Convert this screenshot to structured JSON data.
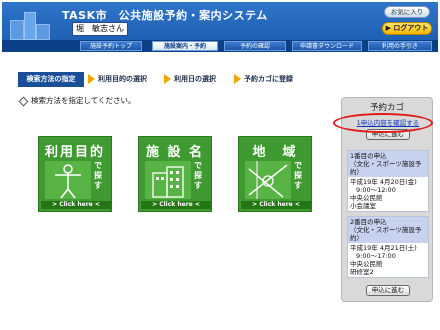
{
  "header": {
    "title": "TASK市　公共施設予約・案内システム",
    "user": "堀　敏志さん",
    "favorites": "お気に入り",
    "logout": "▶ ログアウト"
  },
  "nav": {
    "items": [
      "施設予約トップ",
      "施設案内・予約",
      "予約の確認",
      "申請書ダウンロード",
      "利用の手引き"
    ],
    "active_index": 1
  },
  "steps": {
    "current": "検索方法の指定",
    "next": [
      "利用目的の選択",
      "利用日の選択",
      "予約カゴに登録"
    ]
  },
  "instruction": "検索方法を指定してください。",
  "tiles": [
    {
      "title": "利用目的",
      "vertical": "で探す",
      "click": "> Click here <",
      "icon": "person-icon"
    },
    {
      "title": "施 設 名",
      "vertical": "で探す",
      "click": "> Click here <",
      "icon": "building-icon"
    },
    {
      "title": "地　域",
      "vertical": "で探す",
      "click": "> Click here <",
      "icon": "map-icon"
    }
  ],
  "cart": {
    "title": "予約カゴ",
    "confirm_link": "1申込内容を確認する",
    "apply_button": "申込に進む",
    "entries": [
      {
        "head1": "1番目の申込",
        "head2": "（文化・スポーツ施設予約）",
        "date": "平成19年 4月20日(金)",
        "time": "9:00～12:00",
        "place": "中央公民館",
        "room": "小会議室"
      },
      {
        "head1": "2番目の申込",
        "head2": "（文化・スポーツ施設予約）",
        "date": "平成19年 4月21日(土)",
        "time": "9:00～17:00",
        "place": "中央公民館",
        "room": "研修室2"
      }
    ]
  },
  "colors": {
    "header_blue": "#1d5fb3",
    "nav_dark": "#0b3f86",
    "tile_green": "#3f9b31",
    "accent_orange": "#f0a500",
    "highlight_red": "#e01919"
  }
}
